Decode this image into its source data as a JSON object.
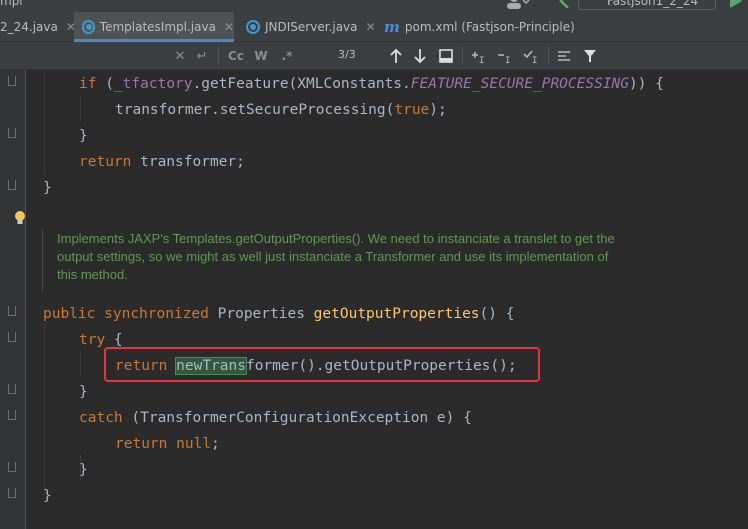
{
  "window": {
    "project_fragment": "mpl",
    "run_config": "Fastjson1_2_24"
  },
  "tabs": [
    {
      "label": "2_24.java",
      "icon": "none",
      "active": false,
      "closable": true
    },
    {
      "label": "TemplatesImpl.java",
      "icon": "java-class-icon",
      "active": true,
      "closable": true
    },
    {
      "label": "JNDIServer.java",
      "icon": "java-class-icon",
      "active": false,
      "closable": true
    },
    {
      "label": "pom.xml (Fastjson-Principle)",
      "icon": "maven-icon",
      "active": false,
      "closable": false
    }
  ],
  "find": {
    "match_case": "Cc",
    "whole_words": "W",
    "regex": ".*",
    "count": "3/3"
  },
  "code": {
    "line1": {
      "kw": "if",
      "rest1": " (",
      "field": "_tfactory",
      "rest2": ".getFeature(XMLConstants.",
      "const": "FEATURE_SECURE_PROCESSING",
      "rest3": ")) {"
    },
    "line2": {
      "prefix": "transformer.setSecureProcessing(",
      "kw": "true",
      "suffix": ");"
    },
    "line3": "}",
    "line4": {
      "kw": "return",
      "rest": " transformer;"
    },
    "line5": "}",
    "doc": [
      "Implements JAXP's Templates.getOutputProperties(). We need to instanciate a translet to get the",
      "output settings, so we might as well just instanciate a Transformer and use its implementation of",
      "this method."
    ],
    "line6": {
      "kw1": "public",
      "kw2": "synchronized",
      "type": "Properties",
      "method": "getOutputProperties",
      "rest": "() {"
    },
    "line7": {
      "kw": "try",
      "rest": " {"
    },
    "line8": {
      "kw": "return",
      "sel": "newTrans",
      "rest": "former().getOutputProperties();"
    },
    "line9": "}",
    "line10": {
      "kw": "catch",
      "rest": " (TransformerConfigurationException e) {"
    },
    "line11": {
      "kw": "return",
      "kw2": "null",
      "rest": ";"
    },
    "line12": "}",
    "line13": "}"
  },
  "colors": {
    "keyword": "#cc7832",
    "method": "#ffc66d",
    "field": "#9876aa",
    "doc": "#629755",
    "highlight": "#e8343e"
  }
}
